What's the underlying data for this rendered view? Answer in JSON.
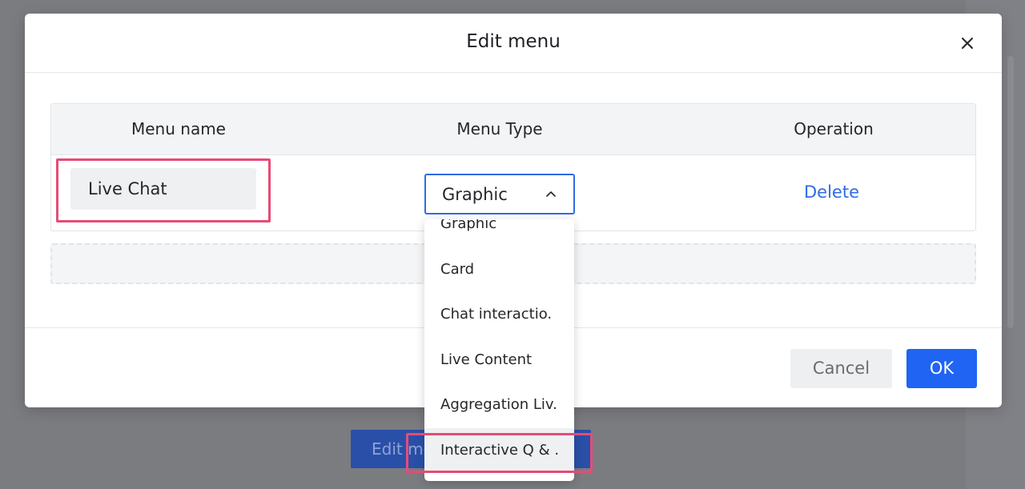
{
  "background": {
    "edit_button_label": "Edit menu"
  },
  "modal": {
    "title": "Edit menu",
    "close_icon": "close-icon",
    "table": {
      "headers": [
        "Menu name",
        "Menu Type",
        "Operation"
      ],
      "row": {
        "menu_name": "Live Chat",
        "menu_type": "Graphic",
        "operation": "Delete"
      }
    },
    "footer": {
      "cancel_label": "Cancel",
      "ok_label": "OK"
    }
  },
  "dropdown": {
    "options": [
      "Graphic",
      "Card",
      "Chat interactio.",
      "Live Content",
      "Aggregation Liv.",
      "Interactive Q & ."
    ],
    "hovered_index": 5
  },
  "colors": {
    "accent": "#1f64f3",
    "link": "#2f6be6",
    "highlight": "#e64b77"
  }
}
